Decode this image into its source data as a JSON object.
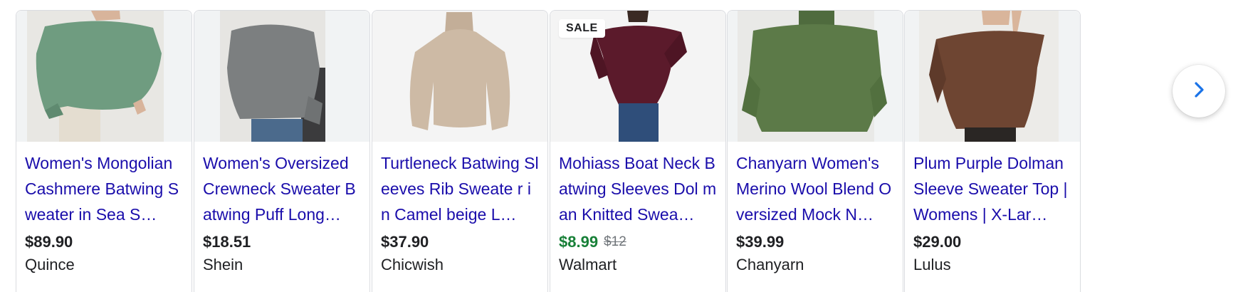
{
  "products": [
    {
      "title": "Women's Mongolian Cashmere Batwing Sweater in Sea S…",
      "price": "$89.90",
      "merchant": "Quince",
      "image": "sage-green-batwing-sweater-photo",
      "sweater_color": "#6f9c80"
    },
    {
      "title": "Women's Oversized Crewneck Sweater Batwing Puff Long…",
      "price": "$18.51",
      "merchant": "Shein",
      "image": "gray-oversized-sweater-photo",
      "sweater_color": "#7c7f80"
    },
    {
      "title": "Turtleneck Batwing Sleeves Rib Sweate r in Camel beige L…",
      "price": "$37.90",
      "merchant": "Chicwish",
      "image": "camel-turtleneck-sweater-photo",
      "sweater_color": "#cdbaa5"
    },
    {
      "title": "Mohiass Boat Neck Batwing Sleeves Dol man Knitted Swea…",
      "price": "$8.99",
      "old_price": "$12",
      "merchant": "Walmart",
      "badge": "SALE",
      "image": "burgundy-boatneck-sweater-photo",
      "sweater_color": "#5b1a2b"
    },
    {
      "title": "Chanyarn Women's Merino Wool Blend Oversized Mock N…",
      "price": "$39.99",
      "merchant": "Chanyarn",
      "image": "olive-mockneck-sweater-photo",
      "sweater_color": "#5c7a48"
    },
    {
      "title": "Plum Purple Dolman Sleeve Sweater Top | Womens | X-Lar…",
      "price": "$29.00",
      "merchant": "Lulus",
      "image": "brown-dolman-sweater-photo",
      "sweater_color": "#6e4532"
    }
  ],
  "next_icon": "chevron-right-icon",
  "colors": {
    "link": "#1a0dab",
    "sale_price": "#188038",
    "old_price": "#70757a",
    "chevron": "#1a73e8"
  }
}
